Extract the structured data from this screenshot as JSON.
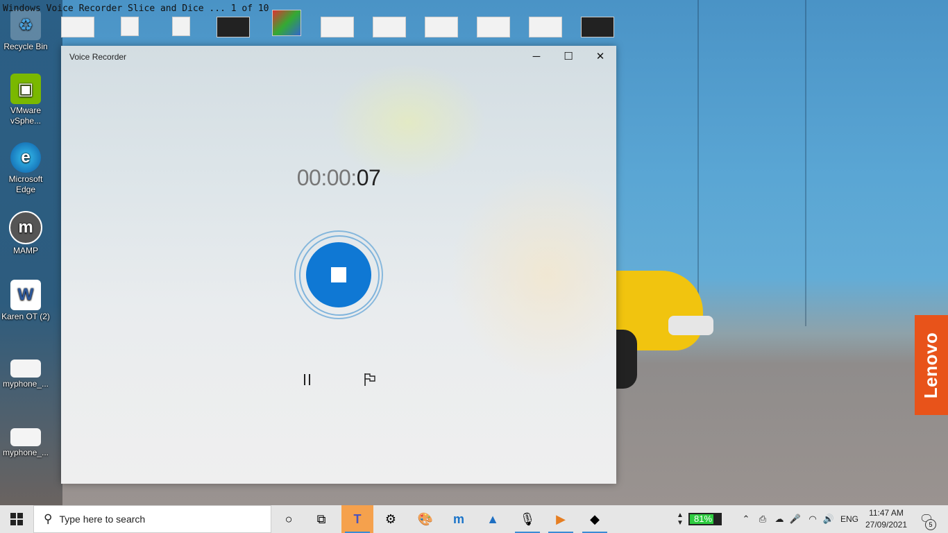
{
  "overlay_title": "Windows Voice Recorder Slice and Dice ... 1 of 10",
  "desktop": {
    "icons": [
      {
        "label": "Recycle Bin",
        "icon": "recycle-bin-icon"
      },
      {
        "label": "VMware vSphe...",
        "icon": "vmware-icon"
      },
      {
        "label": "Microsoft Edge",
        "icon": "edge-icon"
      },
      {
        "label": "MAMP",
        "icon": "mamp-icon"
      },
      {
        "label": "Karen OT (2)",
        "icon": "word-icon"
      },
      {
        "label": "myphone_...",
        "icon": "image-file-icon"
      },
      {
        "label": "myphone_...",
        "icon": "image-file-icon"
      }
    ],
    "brand": "Lenovo"
  },
  "window": {
    "title": "Voice Recorder",
    "controls": {
      "minimize": "─",
      "maximize": "☐",
      "close": "✕"
    },
    "timer": {
      "prefix": "00:00:",
      "seconds": "07"
    }
  },
  "taskbar": {
    "search_placeholder": "Type here to search",
    "battery_percent": "81%",
    "language": "ENG",
    "time": "11:47 AM",
    "date": "27/09/2021",
    "notification_count": "5"
  }
}
